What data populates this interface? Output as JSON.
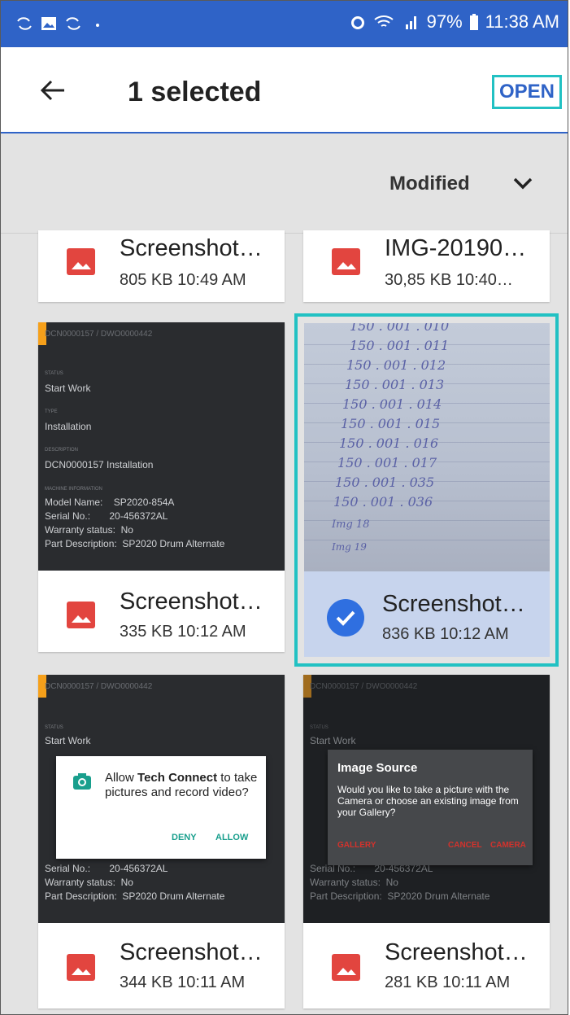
{
  "status_bar": {
    "battery": "97%",
    "time": "11:38 AM"
  },
  "app_bar": {
    "title": "1 selected",
    "open_label": "OPEN"
  },
  "sort": {
    "label": "Modified"
  },
  "files": [
    {
      "name": "Screenshot…",
      "sub": "805 KB 10:49 AM"
    },
    {
      "name": "IMG-20190…",
      "sub": "30,85 KB 10:40…"
    },
    {
      "name": "Screenshot…",
      "sub": "335 KB 10:12 AM"
    },
    {
      "name": "Screenshot…",
      "sub": "836 KB 10:12 AM",
      "selected": true
    },
    {
      "name": "Screenshot…",
      "sub": "344 KB 10:11 AM"
    },
    {
      "name": "Screenshot…",
      "sub": "281 KB 10:11 AM"
    }
  ],
  "thumb_details": {
    "ids": "DCN0000157 / DWO0000442",
    "status_label": "STATUS",
    "status": "Start Work",
    "type_label": "TYPE",
    "type": "Installation",
    "desc_label": "DESCRIPTION",
    "desc": "DCN0000157 Installation",
    "machine_label": "MACHINE INFORMATION",
    "model_line": "Model Name:    SP2020-854A",
    "serial_line": "Serial No.:       20-456372AL",
    "warranty_line": "Warranty status:  No",
    "part_line": "Part Description:  SP2020 Drum Alternate"
  },
  "handwritten_lines": [
    "150 . 001 . 010",
    "150 . 001 . 011",
    "150 . 001 . 012",
    "150 . 001 . 013",
    "150 . 001 . 014",
    "150 . 001 . 015",
    "150 . 001 . 016",
    "150 . 001 . 017",
    "150 . 001 . 035",
    "150 . 001 . 036",
    "Img 18",
    "Img 19"
  ],
  "permission_dialog": {
    "pre": "Allow ",
    "app": "Tech Connect",
    "post": " to take pictures and record video?",
    "deny": "DENY",
    "allow": "ALLOW"
  },
  "image_source_dialog": {
    "title": "Image Source",
    "body": "Would you like to take a picture with the Camera or choose an existing image from your Gallery?",
    "gallery": "GALLERY",
    "cancel": "CANCEL",
    "camera": "CAMERA"
  },
  "colors": {
    "accent": "#2f63c7",
    "highlight": "#22c1c3",
    "file_icon": "#e2453f"
  }
}
